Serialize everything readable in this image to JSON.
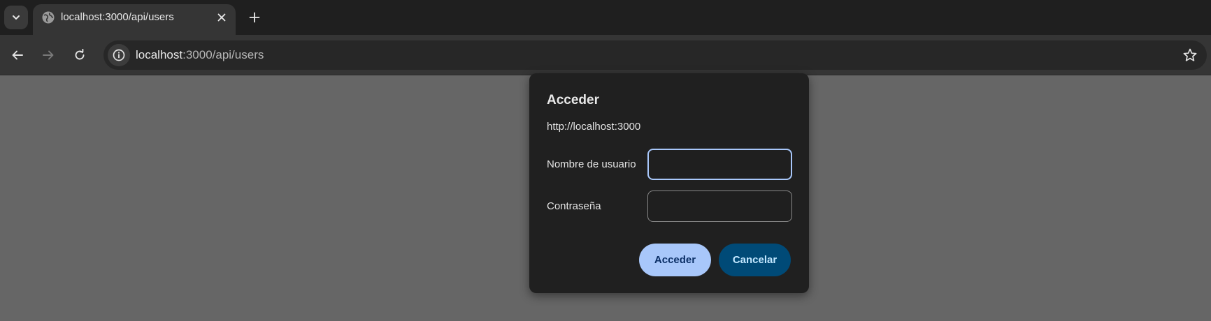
{
  "browser": {
    "tab": {
      "title": "localhost:3000/api/users",
      "favicon": "globe-icon"
    },
    "omnibox": {
      "host": "localhost",
      "path": ":3000/api/users"
    },
    "icons": {
      "tab_search": "chevron-down-icon",
      "tab_close": "close-icon",
      "new_tab": "plus-icon",
      "back": "arrow-left-icon",
      "forward": "arrow-right-icon",
      "reload": "reload-icon",
      "site_info": "info-icon",
      "bookmark": "star-icon"
    }
  },
  "dialog": {
    "title": "Acceder",
    "origin": "http://localhost:3000",
    "username_label": "Nombre de usuario",
    "username_value": "",
    "password_label": "Contraseña",
    "password_value": "",
    "submit_label": "Acceder",
    "cancel_label": "Cancelar"
  },
  "colors": {
    "page_background": "#666666",
    "chrome_dark": "#1f1f1f",
    "toolbar": "#353535",
    "dialog_background": "#202020",
    "primary_button": "#a8c7fa",
    "secondary_button": "#004a77",
    "focus_ring": "#a8c7fa"
  }
}
